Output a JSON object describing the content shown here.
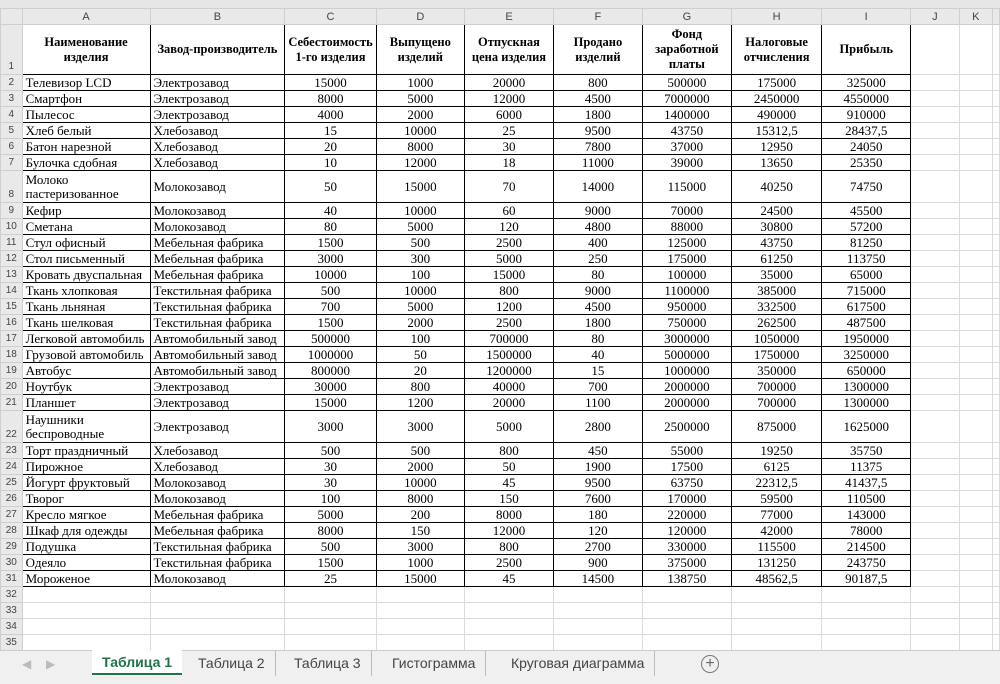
{
  "columns": [
    "A",
    "B",
    "C",
    "D",
    "E",
    "F",
    "G",
    "H",
    "I",
    "J",
    "K"
  ],
  "headers": [
    "Наименование изделия",
    "Завод-производитель",
    "Себестоимость 1-го изделия",
    "Выпущено изделий",
    "Отпускная цена изделия",
    "Продано изделий",
    "Фонд заработной платы",
    "Налоговые отчисления",
    "Прибыль"
  ],
  "rows": [
    [
      "Телевизор LCD",
      "Электрозавод",
      "15000",
      "1000",
      "20000",
      "800",
      "500000",
      "175000",
      "325000"
    ],
    [
      "Смартфон",
      "Электрозавод",
      "8000",
      "5000",
      "12000",
      "4500",
      "7000000",
      "2450000",
      "4550000"
    ],
    [
      "Пылесос",
      "Электрозавод",
      "4000",
      "2000",
      "6000",
      "1800",
      "1400000",
      "490000",
      "910000"
    ],
    [
      "Хлеб белый",
      "Хлебозавод",
      "15",
      "10000",
      "25",
      "9500",
      "43750",
      "15312,5",
      "28437,5"
    ],
    [
      "Батон нарезной",
      "Хлебозавод",
      "20",
      "8000",
      "30",
      "7800",
      "37000",
      "12950",
      "24050"
    ],
    [
      "Булочка сдобная",
      "Хлебозавод",
      "10",
      "12000",
      "18",
      "11000",
      "39000",
      "13650",
      "25350"
    ],
    [
      "Молоко пастеризованное",
      "Молокозавод",
      "50",
      "15000",
      "70",
      "14000",
      "115000",
      "40250",
      "74750"
    ],
    [
      "Кефир",
      "Молокозавод",
      "40",
      "10000",
      "60",
      "9000",
      "70000",
      "24500",
      "45500"
    ],
    [
      "Сметана",
      "Молокозавод",
      "80",
      "5000",
      "120",
      "4800",
      "88000",
      "30800",
      "57200"
    ],
    [
      "Стул офисный",
      "Мебельная фабрика",
      "1500",
      "500",
      "2500",
      "400",
      "125000",
      "43750",
      "81250"
    ],
    [
      "Стол письменный",
      "Мебельная фабрика",
      "3000",
      "300",
      "5000",
      "250",
      "175000",
      "61250",
      "113750"
    ],
    [
      "Кровать двуспальная",
      "Мебельная фабрика",
      "10000",
      "100",
      "15000",
      "80",
      "100000",
      "35000",
      "65000"
    ],
    [
      "Ткань хлопковая",
      "Текстильная фабрика",
      "500",
      "10000",
      "800",
      "9000",
      "1100000",
      "385000",
      "715000"
    ],
    [
      "Ткань льняная",
      "Текстильная фабрика",
      "700",
      "5000",
      "1200",
      "4500",
      "950000",
      "332500",
      "617500"
    ],
    [
      "Ткань шелковая",
      "Текстильная фабрика",
      "1500",
      "2000",
      "2500",
      "1800",
      "750000",
      "262500",
      "487500"
    ],
    [
      "Легковой автомобиль",
      "Автомобильный завод",
      "500000",
      "100",
      "700000",
      "80",
      "3000000",
      "1050000",
      "1950000"
    ],
    [
      "Грузовой автомобиль",
      "Автомобильный завод",
      "1000000",
      "50",
      "1500000",
      "40",
      "5000000",
      "1750000",
      "3250000"
    ],
    [
      "Автобус",
      "Автомобильный завод",
      "800000",
      "20",
      "1200000",
      "15",
      "1000000",
      "350000",
      "650000"
    ],
    [
      "Ноутбук",
      "Электрозавод",
      "30000",
      "800",
      "40000",
      "700",
      "2000000",
      "700000",
      "1300000"
    ],
    [
      "Планшет",
      "Электрозавод",
      "15000",
      "1200",
      "20000",
      "1100",
      "2000000",
      "700000",
      "1300000"
    ],
    [
      "Наушники беспроводные",
      "Электрозавод",
      "3000",
      "3000",
      "5000",
      "2800",
      "2500000",
      "875000",
      "1625000"
    ],
    [
      "Торт праздничный",
      "Хлебозавод",
      "500",
      "500",
      "800",
      "450",
      "55000",
      "19250",
      "35750"
    ],
    [
      "Пирожное",
      "Хлебозавод",
      "30",
      "2000",
      "50",
      "1900",
      "17500",
      "6125",
      "11375"
    ],
    [
      "Йогурт фруктовый",
      "Молокозавод",
      "30",
      "10000",
      "45",
      "9500",
      "63750",
      "22312,5",
      "41437,5"
    ],
    [
      "Творог",
      "Молокозавод",
      "100",
      "8000",
      "150",
      "7600",
      "170000",
      "59500",
      "110500"
    ],
    [
      "Кресло мягкое",
      "Мебельная фабрика",
      "5000",
      "200",
      "8000",
      "180",
      "220000",
      "77000",
      "143000"
    ],
    [
      "Шкаф для одежды",
      "Мебельная фабрика",
      "8000",
      "150",
      "12000",
      "120",
      "120000",
      "42000",
      "78000"
    ],
    [
      "Подушка",
      "Текстильная фабрика",
      "500",
      "3000",
      "800",
      "2700",
      "330000",
      "115500",
      "214500"
    ],
    [
      "Одеяло",
      "Текстильная фабрика",
      "1500",
      "1000",
      "2500",
      "900",
      "375000",
      "131250",
      "243750"
    ],
    [
      "Мороженое",
      "Молокозавод",
      "25",
      "15000",
      "45",
      "14500",
      "138750",
      "48562,5",
      "90187,5"
    ]
  ],
  "empty_rows": [
    32,
    33,
    34,
    35
  ],
  "sheet_tabs": [
    "Таблица 1",
    "Таблица 2",
    "Таблица 3",
    "Гистограмма",
    "Круговая диаграмма"
  ],
  "active_tab": "Таблица 1",
  "add_sheet_label": "+",
  "colors": {
    "accent": "#217346"
  }
}
